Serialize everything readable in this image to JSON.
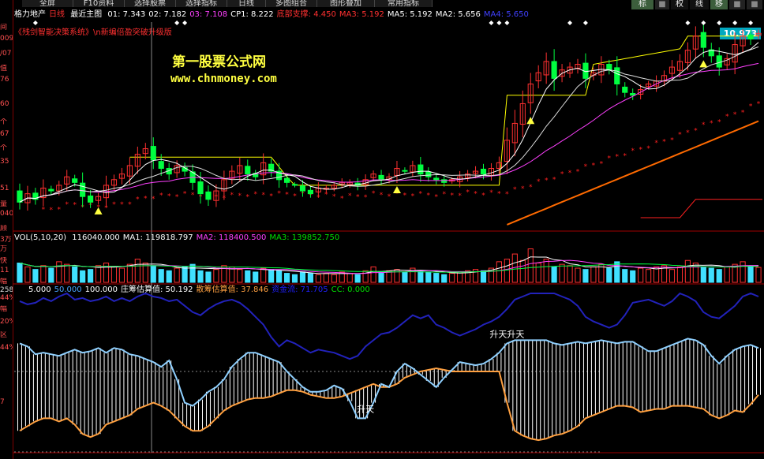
{
  "toolbar": {
    "buttons": [
      "全屏",
      "F10资料",
      "选择股票",
      "选择指标",
      "日线",
      "多图组合",
      "图形叠加",
      "常用指标"
    ],
    "right": [
      "标",
      "■",
      "权",
      "线",
      "移",
      "■",
      "■"
    ]
  },
  "left_axis": [
    "间",
    "009",
    "/07",
    "值",
    "76",
    "60",
    "个",
    "67",
    "个",
    "35",
    "51",
    "量",
    "040",
    "顾",
    "3万",
    "万",
    "快",
    "11",
    "幅",
    "258",
    "44%",
    "幅",
    "20%",
    "区",
    "44%",
    "7"
  ],
  "price_header": {
    "stock": "格力地产",
    "period": "日线",
    "chart_name": "最近主图",
    "items": [
      {
        "text": "01: 7.343",
        "color": "#ffffff"
      },
      {
        "text": "02: 7.182",
        "color": "#ffffff"
      },
      {
        "text": "03: 7.108",
        "color": "#ff40ff"
      },
      {
        "text": "CP1: 8.222",
        "color": "#ffffff"
      },
      {
        "text": "底部支撑: 4.450",
        "color": "#ff3030"
      },
      {
        "text": "MA3: 5.192",
        "color": "#ff3030"
      },
      {
        "text": "MA5: 5.192",
        "color": "#ffffff"
      },
      {
        "text": "MA2: 5.656",
        "color": "#ffffff"
      },
      {
        "text": "MA4: 5.650",
        "color": "#4040ff"
      }
    ]
  },
  "subtitle": "《残剑智能决策系统》\\n新编倍盈突破升级版",
  "watermark": {
    "line1": "第一股票公式网",
    "line2": "www.chnmoney.com"
  },
  "price_label": "10.973",
  "vol_header": {
    "name": "VOL(5,10,20)",
    "items": [
      {
        "text": "116040.000",
        "color": "#ffffff"
      },
      {
        "text": "MA1: 119818.797",
        "color": "#ffffff"
      },
      {
        "text": "MA2: 118400.500",
        "color": "#ff40ff"
      },
      {
        "text": "MA3: 139852.750",
        "color": "#00e000"
      }
    ]
  },
  "ind_header": {
    "items": [
      {
        "text": "5.000",
        "color": "#ffffff"
      },
      {
        "text": "50.000",
        "color": "#4aa3ff"
      },
      {
        "text": "100.000",
        "color": "#ffffff"
      },
      {
        "text": "庄筹估算值: 50.192",
        "color": "#ffffff"
      },
      {
        "text": "散筹估算值: 37.846",
        "color": "#ffa040"
      },
      {
        "text": "资金流: 71.705",
        "color": "#2020ff"
      },
      {
        "text": "CC: 0.000",
        "color": "#00e000"
      }
    ]
  },
  "colors": {
    "up": "#ff3030",
    "down": "#00ff40",
    "ma1": "#ffffff",
    "ma2": "#ffff00",
    "ma3": "#ff40ff",
    "support": "#ff2020",
    "trend": "#ff6a00",
    "zhuang": "#8fd0ff",
    "san": "#ffa040",
    "fund": "#2222bb"
  },
  "chart_data": [
    {
      "type": "candlestick",
      "title": "格力地产 日线",
      "n": 95,
      "start": 5.4,
      "ylim": [
        4.0,
        11.4
      ],
      "close": [
        5.0,
        5.3,
        5.1,
        5.5,
        5.4,
        5.6,
        5.9,
        5.7,
        5.2,
        5.0,
        5.2,
        5.6,
        5.8,
        6.0,
        6.3,
        6.7,
        6.9,
        6.5,
        6.2,
        6.0,
        6.3,
        6.1,
        5.7,
        5.3,
        5.1,
        5.4,
        5.8,
        6.1,
        6.3,
        6.0,
        5.9,
        6.4,
        6.1,
        5.8,
        5.7,
        5.6,
        5.4,
        5.3,
        5.5,
        5.5,
        5.6,
        5.7,
        5.7,
        5.6,
        5.8,
        6.0,
        5.8,
        5.9,
        6.2,
        6.1,
        6.3,
        6.0,
        5.9,
        5.8,
        5.7,
        5.8,
        5.9,
        6.0,
        6.1,
        6.0,
        6.2,
        6.4,
        7.2,
        7.8,
        8.5,
        9.2,
        9.6,
        10.0,
        9.4,
        9.7,
        9.8,
        9.9,
        9.4,
        9.6,
        9.9,
        9.7,
        9.2,
        8.9,
        8.8,
        9.0,
        9.2,
        9.3,
        9.5,
        9.8,
        10.0,
        10.4,
        10.9,
        10.5,
        10.2,
        9.8,
        10.1,
        10.6,
        10.9,
        10.8,
        11.0
      ],
      "markers": [
        {
          "label": "升天",
          "index": 44
        },
        {
          "label": "升天升天",
          "index": 62
        }
      ]
    },
    {
      "type": "bar",
      "title": "VOL(5,10,20)",
      "n": 95,
      "ylim": [
        0,
        300000
      ],
      "volume": [
        150000,
        120000,
        100000,
        130000,
        110000,
        160000,
        140000,
        120000,
        90000,
        100000,
        130000,
        150000,
        120000,
        110000,
        140000,
        180000,
        150000,
        130000,
        100000,
        90000,
        110000,
        120000,
        140000,
        90000,
        80000,
        100000,
        130000,
        120000,
        100000,
        90000,
        80000,
        110000,
        100000,
        90000,
        70000,
        60000,
        80000,
        70000,
        60000,
        70000,
        60000,
        80000,
        70000,
        60000,
        90000,
        120000,
        80000,
        90000,
        100000,
        80000,
        110000,
        90000,
        80000,
        70000,
        60000,
        70000,
        80000,
        90000,
        100000,
        90000,
        110000,
        160000,
        180000,
        220000,
        170000,
        260000,
        150000,
        180000,
        120000,
        140000,
        130000,
        110000,
        100000,
        120000,
        140000,
        110000,
        160000,
        100000,
        90000,
        110000,
        100000,
        120000,
        130000,
        100000,
        120000,
        170000,
        150000,
        120000,
        110000,
        100000,
        120000,
        140000,
        160000,
        120000,
        116040
      ]
    },
    {
      "type": "line",
      "title": "庄筹 / 散筹 / 资金流",
      "n": 95,
      "ylim": [
        0,
        100
      ],
      "series": [
        {
          "name": "庄筹估算值",
          "values": [
            68,
            66,
            61,
            62,
            61,
            60,
            62,
            64,
            62,
            63,
            65,
            62,
            65,
            64,
            61,
            60,
            58,
            56,
            53,
            57,
            45,
            30,
            28,
            32,
            37,
            40,
            45,
            53,
            58,
            62,
            62,
            60,
            58,
            56,
            50,
            45,
            40,
            37,
            37,
            38,
            41,
            39,
            31,
            20,
            20,
            30,
            42,
            40,
            50,
            55,
            52,
            48,
            44,
            40,
            46,
            51,
            56,
            55,
            54,
            55,
            58,
            62,
            68,
            70,
            70,
            70,
            70,
            70,
            68,
            67,
            68,
            69,
            68,
            69,
            70,
            69,
            68,
            69,
            69,
            66,
            63,
            63,
            65,
            67,
            69,
            71,
            70,
            67,
            60,
            55,
            60,
            64,
            66,
            67,
            65
          ]
        },
        {
          "name": "散筹估算值",
          "values": [
            12,
            15,
            18,
            20,
            20,
            18,
            20,
            16,
            10,
            8,
            10,
            16,
            18,
            20,
            22,
            26,
            28,
            30,
            28,
            25,
            20,
            15,
            12,
            12,
            15,
            20,
            25,
            28,
            30,
            32,
            33,
            33,
            34,
            36,
            38,
            38,
            37,
            35,
            34,
            33,
            33,
            34,
            36,
            38,
            40,
            42,
            40,
            40,
            42,
            46,
            48,
            50,
            51,
            52,
            51,
            50,
            50,
            50,
            50,
            50,
            50,
            50,
            30,
            12,
            9,
            7,
            6,
            7,
            9,
            10,
            12,
            15,
            20,
            22,
            24,
            26,
            28,
            28,
            27,
            24,
            25,
            26,
            26,
            28,
            28,
            28,
            27,
            26,
            22,
            20,
            22,
            25,
            24,
            29,
            35
          ]
        },
        {
          "name": "资金流",
          "values": [
            95,
            93,
            94,
            97,
            95,
            98,
            100,
            96,
            97,
            95,
            96,
            98,
            95,
            97,
            95,
            98,
            100,
            98,
            97,
            95,
            96,
            92,
            88,
            86,
            90,
            93,
            95,
            96,
            94,
            90,
            85,
            80,
            72,
            66,
            70,
            68,
            65,
            62,
            64,
            63,
            62,
            60,
            58,
            60,
            66,
            70,
            74,
            75,
            78,
            82,
            86,
            84,
            86,
            80,
            78,
            75,
            73,
            75,
            77,
            80,
            82,
            85,
            90,
            96,
            98,
            100,
            100,
            100,
            100,
            98,
            96,
            92,
            85,
            82,
            80,
            78,
            80,
            86,
            94,
            95,
            96,
            94,
            92,
            95,
            100,
            98,
            95,
            88,
            85,
            84,
            88,
            92,
            98,
            100,
            98
          ]
        }
      ]
    }
  ]
}
